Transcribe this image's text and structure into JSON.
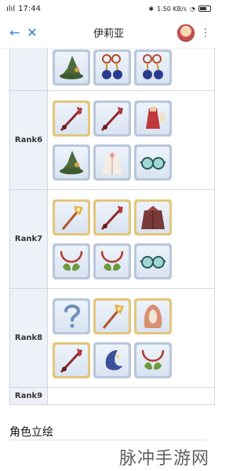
{
  "status_bar": {
    "carrier": "ılıl",
    "time": "17:44",
    "speed": "1.50 KB/s",
    "battery": ""
  },
  "header": {
    "title": "伊莉亚"
  },
  "rows": [
    {
      "rank": "",
      "lines": [
        [
          "hat",
          "amulet",
          "amulet"
        ]
      ],
      "frames": [
        [
          "silver",
          "silver",
          "silver"
        ]
      ]
    },
    {
      "rank": "Rank6",
      "lines": [
        [
          "staff",
          "staff",
          "dress"
        ],
        [
          "hat",
          "robe",
          "goggles"
        ]
      ],
      "frames": [
        [
          "gold",
          "silver",
          "silver"
        ],
        [
          "silver",
          "silver",
          "silver"
        ]
      ]
    },
    {
      "rank": "Rank7",
      "lines": [
        [
          "wand",
          "staff",
          "cloak"
        ],
        [
          "necklace",
          "necklace",
          "goggles"
        ]
      ],
      "frames": [
        [
          "gold",
          "gold",
          "gold"
        ],
        [
          "silver",
          "silver",
          "silver"
        ]
      ]
    },
    {
      "rank": "Rank8",
      "lines": [
        [
          "question",
          "wand",
          "hood"
        ],
        [
          "staff",
          "moon",
          "necklace"
        ]
      ],
      "frames": [
        [
          "silver",
          "gold",
          "gold"
        ],
        [
          "gold",
          "silver",
          "silver"
        ]
      ]
    },
    {
      "rank": "Rank9",
      "lines": [],
      "frames": []
    }
  ],
  "section": {
    "title": "角色立绘"
  },
  "watermark": "脉冲手游网"
}
